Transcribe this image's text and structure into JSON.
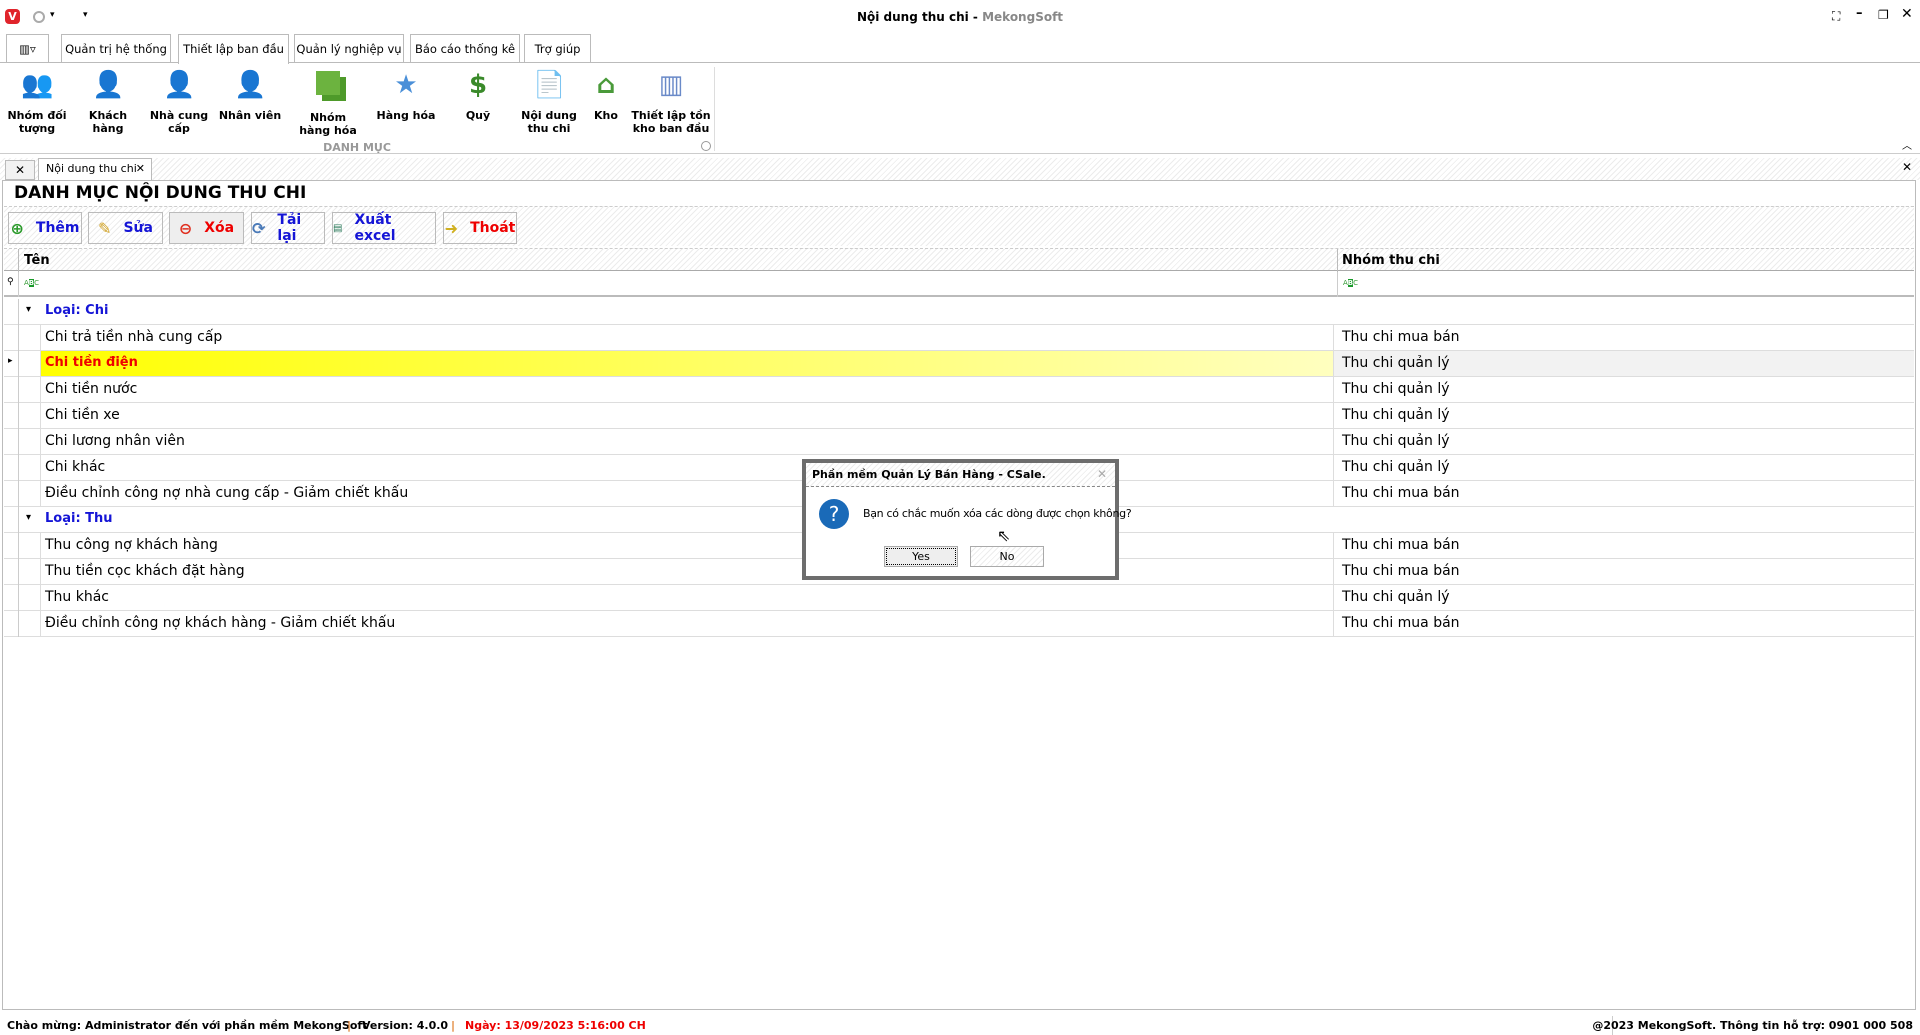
{
  "window": {
    "title": "Nội dung thu chi",
    "app": "MekongSoft"
  },
  "ribbon_tabs": [
    "Quản trị hệ thống",
    "Thiết lập ban đầu",
    "Quản lý nghiệp vụ",
    "Báo cáo thống kê",
    "Trợ giúp"
  ],
  "ribbon_group": "DANH MỤC",
  "ribbon_buttons": [
    {
      "label": "Nhóm đối tượng",
      "icon": "group-users-icon"
    },
    {
      "label": "Khách hàng",
      "icon": "customer-icon"
    },
    {
      "label": "Nhà cung cấp",
      "icon": "supplier-icon"
    },
    {
      "label": "Nhân viên",
      "icon": "employee-icon"
    },
    {
      "label": "Nhóm hàng hóa",
      "icon": "product-group-icon"
    },
    {
      "label": "Hàng hóa",
      "icon": "star-icon"
    },
    {
      "label": "Quỹ",
      "icon": "money-icon"
    },
    {
      "label": "Nội dung thu chi",
      "icon": "document-add-icon"
    },
    {
      "label": "Kho",
      "icon": "warehouse-icon"
    },
    {
      "label": "Thiết lập tồn kho ban đầu",
      "icon": "columns-icon"
    }
  ],
  "doc_tab": "Nội dung thu chi",
  "page_title": "DANH MỤC NỘI DUNG THU CHI",
  "toolbar": {
    "add": "Thêm",
    "edit": "Sửa",
    "delete": "Xóa",
    "reload": "Tải lại",
    "export": "Xuất excel",
    "exit": "Thoát"
  },
  "grid": {
    "columns": [
      "Tên",
      "Nhóm thu chi"
    ],
    "groups": [
      {
        "label": "Loại: Chi",
        "rows": [
          [
            "Chi trả tiền nhà cung cấp",
            "Thu chi mua bán"
          ],
          [
            "Chi tiền điện",
            "Thu chi quản lý"
          ],
          [
            "Chi tiền nước",
            "Thu chi quản lý"
          ],
          [
            "Chi tiền xe",
            "Thu chi quản lý"
          ],
          [
            "Chi lương nhân viên",
            "Thu chi quản lý"
          ],
          [
            "Chi khác",
            "Thu chi quản lý"
          ],
          [
            "Điều chỉnh công nợ nhà cung cấp - Giảm chiết khấu",
            "Thu chi mua bán"
          ]
        ]
      },
      {
        "label": "Loại: Thu",
        "rows": [
          [
            "Thu công nợ khách hàng",
            "Thu chi mua bán"
          ],
          [
            "Thu tiền cọc khách đặt hàng",
            "Thu chi mua bán"
          ],
          [
            "Thu khác",
            "Thu chi quản lý"
          ],
          [
            "Điều chỉnh công nợ khách hàng - Giảm chiết khấu",
            "Thu chi mua bán"
          ]
        ]
      }
    ]
  },
  "dialog": {
    "title": "Phần mềm Quản Lý Bán Hàng - CSale.",
    "message": "Bạn có chắc muốn xóa các dòng được chọn không?",
    "yes": "Yes",
    "no": "No"
  },
  "status": {
    "welcome": "Chào mừng: Administrator đến với phần mềm MekongSoft",
    "version": "Version: 4.0.0",
    "date": "Ngày: 13/09/2023 5:16:00 CH",
    "copyright": "@2023 MekongSoft. Thông tin hỗ trợ: 0901 000 508"
  },
  "colors": {
    "accent": "#1515d6",
    "danger": "#e00000",
    "selected_row": "#ffff00"
  }
}
